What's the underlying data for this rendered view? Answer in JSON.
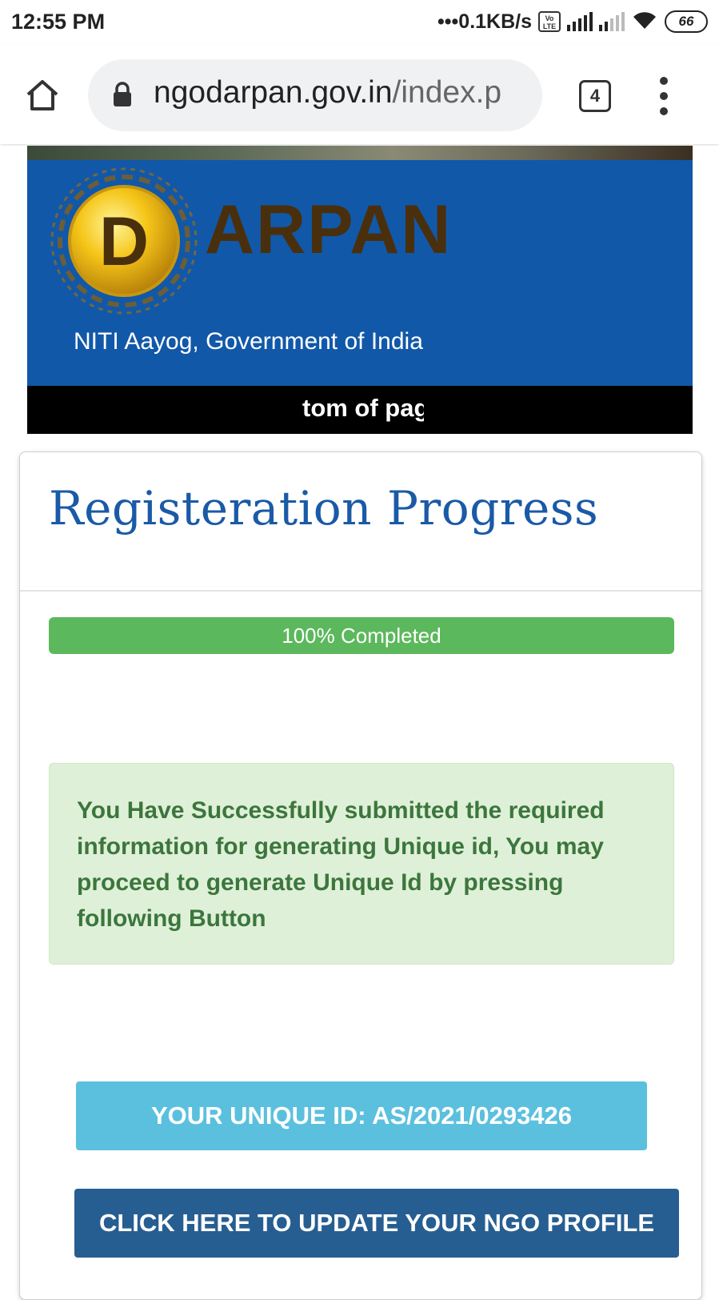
{
  "status_bar": {
    "time": "12:55 PM",
    "net_speed": "•••0.1KB/s",
    "volte_badge": "Vo LTE",
    "battery": "66",
    "icons": [
      "signal-icon",
      "wifi-icon",
      "battery-icon"
    ]
  },
  "browser": {
    "url_host": "ngodarpan.gov.in",
    "url_path": "/index.p",
    "tab_count": "4",
    "icons": [
      "home-icon",
      "lock-icon",
      "tabs-icon",
      "more-menu-icon"
    ]
  },
  "banner": {
    "logo_letter": "D",
    "brand_text": "ARPAN",
    "tagline": "NITI Aayog, Government of India",
    "ticker_text": "tom of pag"
  },
  "card": {
    "title": "Registeration Progress",
    "progress": {
      "label": "100% Completed",
      "percent": 100
    },
    "alert_text": "You Have Successfully submitted the required information for generating Unique id, You may proceed to generate Unique Id by pressing following Button",
    "unique_id_text": "YOUR UNIQUE ID: AS/2021/0293426",
    "update_button_label": "CLICK HERE TO UPDATE YOUR NGO PROFILE"
  },
  "colors": {
    "banner_blue": "#1158a8",
    "title_blue": "#1a5aa6",
    "progress_green": "#5cb85c",
    "alert_bg": "#dff0d8",
    "alert_text": "#3c763d",
    "uid_bg": "#5bc0de",
    "button_bg": "#275e91"
  }
}
